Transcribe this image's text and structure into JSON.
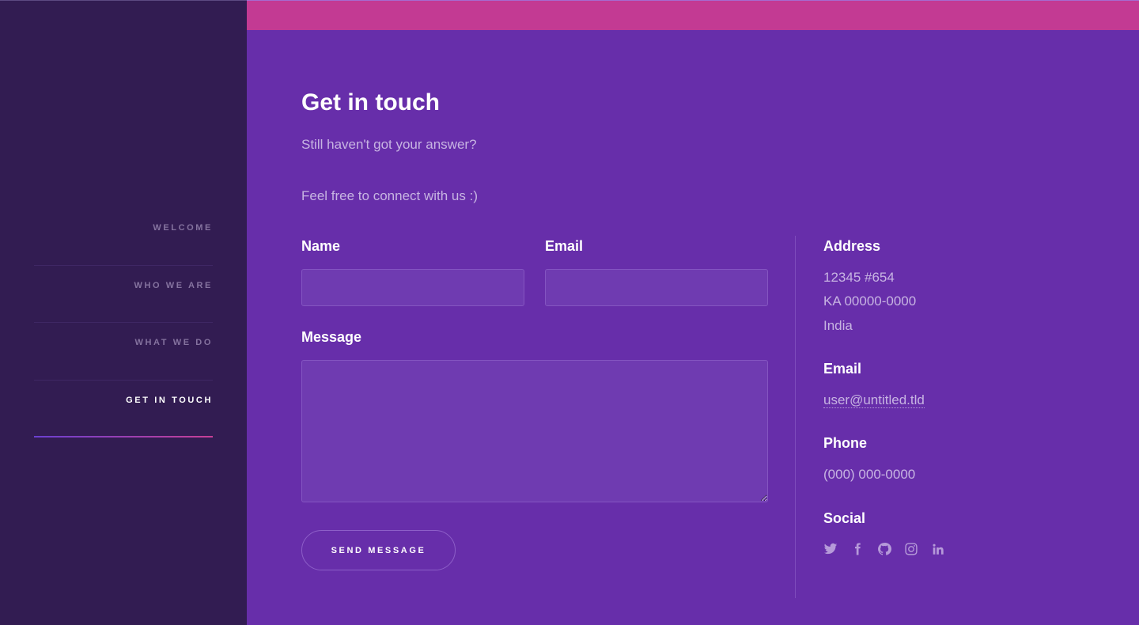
{
  "nav": {
    "items": [
      {
        "label": "Welcome",
        "active": false
      },
      {
        "label": "Who we are",
        "active": false
      },
      {
        "label": "What we do",
        "active": false
      },
      {
        "label": "Get in touch",
        "active": true
      }
    ]
  },
  "colors": {
    "sidebar_bg": "#321c52",
    "main_bg": "#672eaa",
    "accent_bar": "#c33a93",
    "muted_text": "#c7b4e2"
  },
  "contact": {
    "title": "Get in touch",
    "intro_1": "Still haven't got your answer?",
    "intro_2": "Feel free to connect with us :)",
    "form": {
      "name_label": "Name",
      "name_value": "",
      "email_label": "Email",
      "email_value": "",
      "message_label": "Message",
      "message_value": "",
      "send_label": "Send Message"
    },
    "info": {
      "address_heading": "Address",
      "address_line_1": "12345 #654",
      "address_line_2": "KA 00000-0000",
      "address_line_3": "India",
      "email_heading": "Email",
      "email_value": "user@untitled.tld",
      "phone_heading": "Phone",
      "phone_value": "(000) 000-0000",
      "social_heading": "Social",
      "social_icons": [
        "twitter-icon",
        "facebook-icon",
        "github-icon",
        "instagram-icon",
        "linkedin-icon"
      ]
    }
  }
}
